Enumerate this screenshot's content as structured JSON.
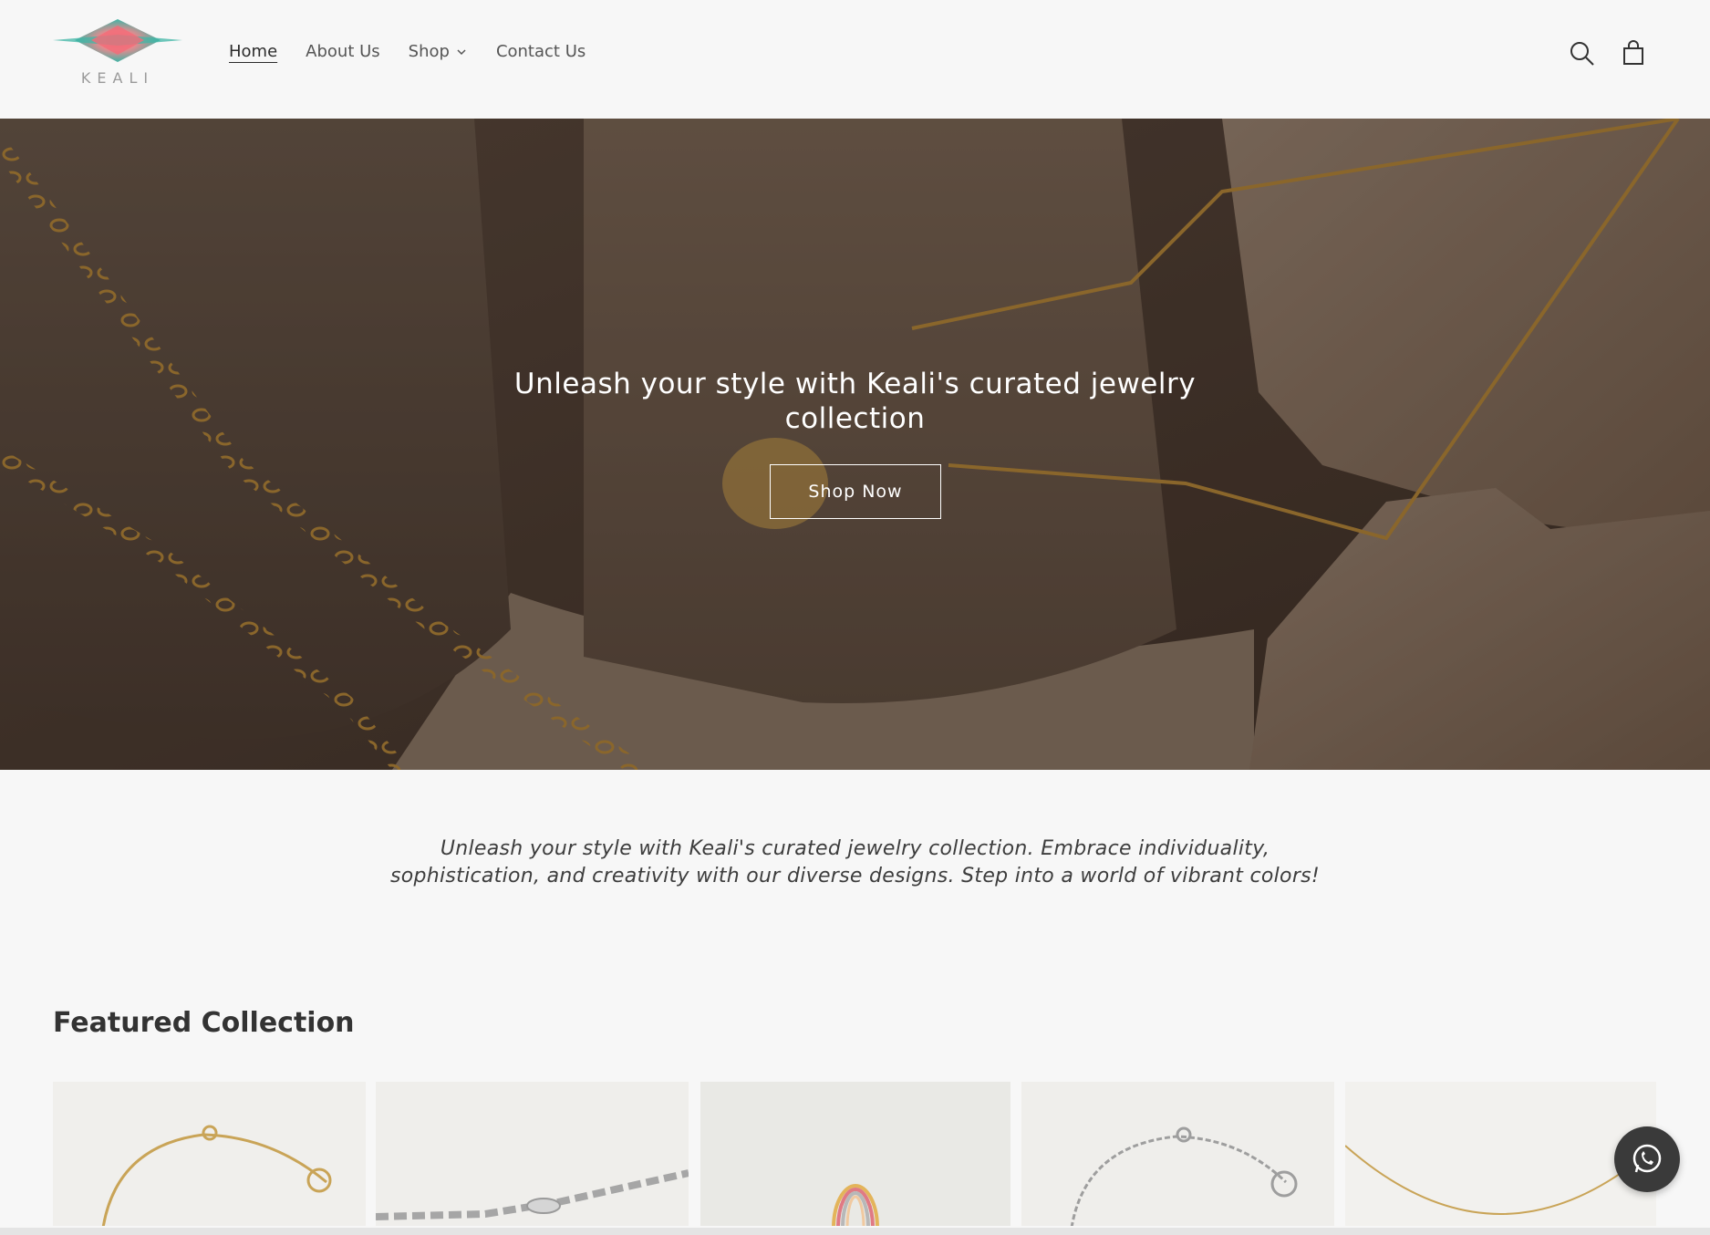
{
  "brand": {
    "logo_text": "KEALI"
  },
  "nav": {
    "items": [
      {
        "label": "Home",
        "active": true
      },
      {
        "label": "About Us",
        "active": false
      },
      {
        "label": "Shop",
        "active": false,
        "has_dropdown": true
      },
      {
        "label": "Contact Us",
        "active": false
      }
    ]
  },
  "header_icons": [
    "search-icon",
    "cart-icon"
  ],
  "hero": {
    "title": "Unleash your style with Keali's curated jewelry collection",
    "button_label": "Shop Now"
  },
  "intro": {
    "text": "Unleash your style with Keali's curated jewelry collection. Embrace individuality, sophistication, and creativity with our diverse designs. Step into a world of vibrant colors!"
  },
  "featured": {
    "title": "Featured Collection",
    "products": [
      {
        "kind": "gold-bracelet-with-charm"
      },
      {
        "kind": "silver-chain-bracelet"
      },
      {
        "kind": "multicolor-ring"
      },
      {
        "kind": "silver-bracelet-with-charm"
      },
      {
        "kind": "gold-necklace"
      }
    ]
  },
  "colors": {
    "background": "#f7f7f7",
    "text": "#2b2b2b",
    "logo_teal": "#3fb5a6",
    "logo_pink": "#f0737c",
    "whatsapp_bg": "#3a3a3a"
  }
}
